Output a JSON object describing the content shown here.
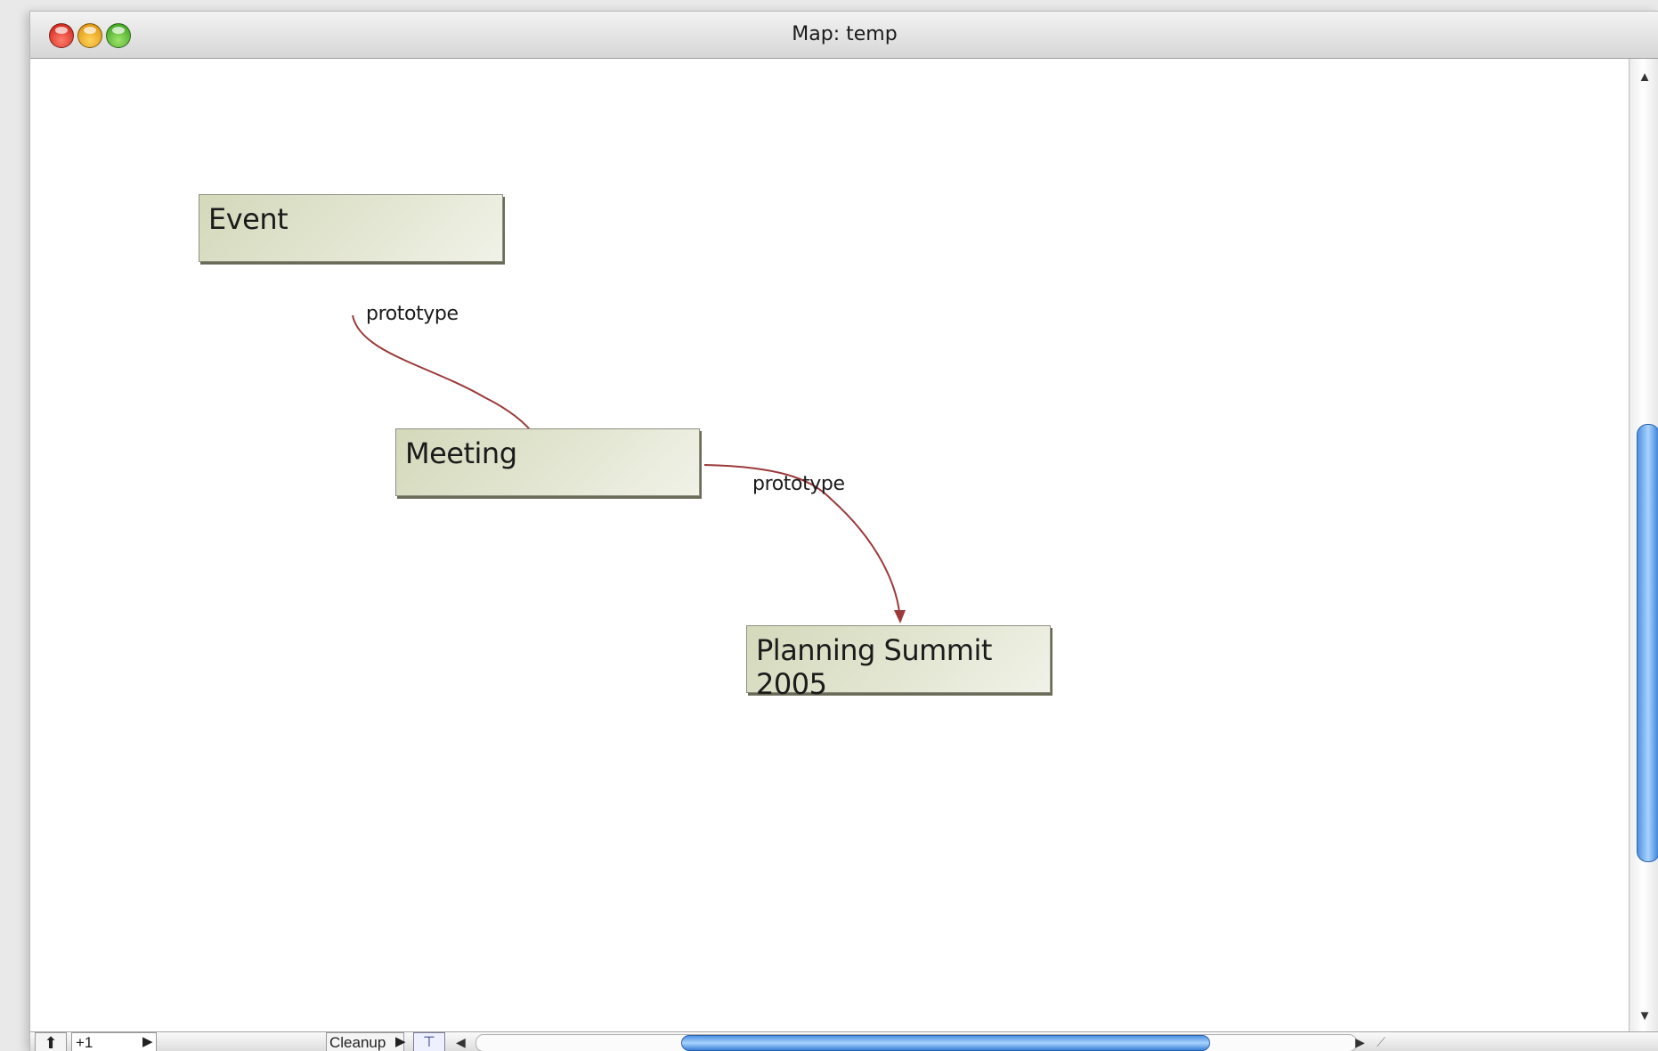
{
  "window": {
    "title": "Map: temp"
  },
  "map": {
    "nodes": [
      {
        "label": "Event"
      },
      {
        "label": "Meeting"
      },
      {
        "label": "Planning Summit 2005"
      }
    ],
    "links": [
      {
        "label": "prototype"
      },
      {
        "label": "prototype"
      }
    ],
    "link_color": "#9b3a3a",
    "node_fill": "#dde1c8"
  },
  "bottombar": {
    "level": "+1",
    "cleanup_label": "Cleanup"
  },
  "icons": {
    "up": "up-arrow-icon",
    "level_menu": "triangle-right-icon",
    "cleanup_menu": "triangle-right-icon",
    "tool": "link-tool-icon"
  }
}
